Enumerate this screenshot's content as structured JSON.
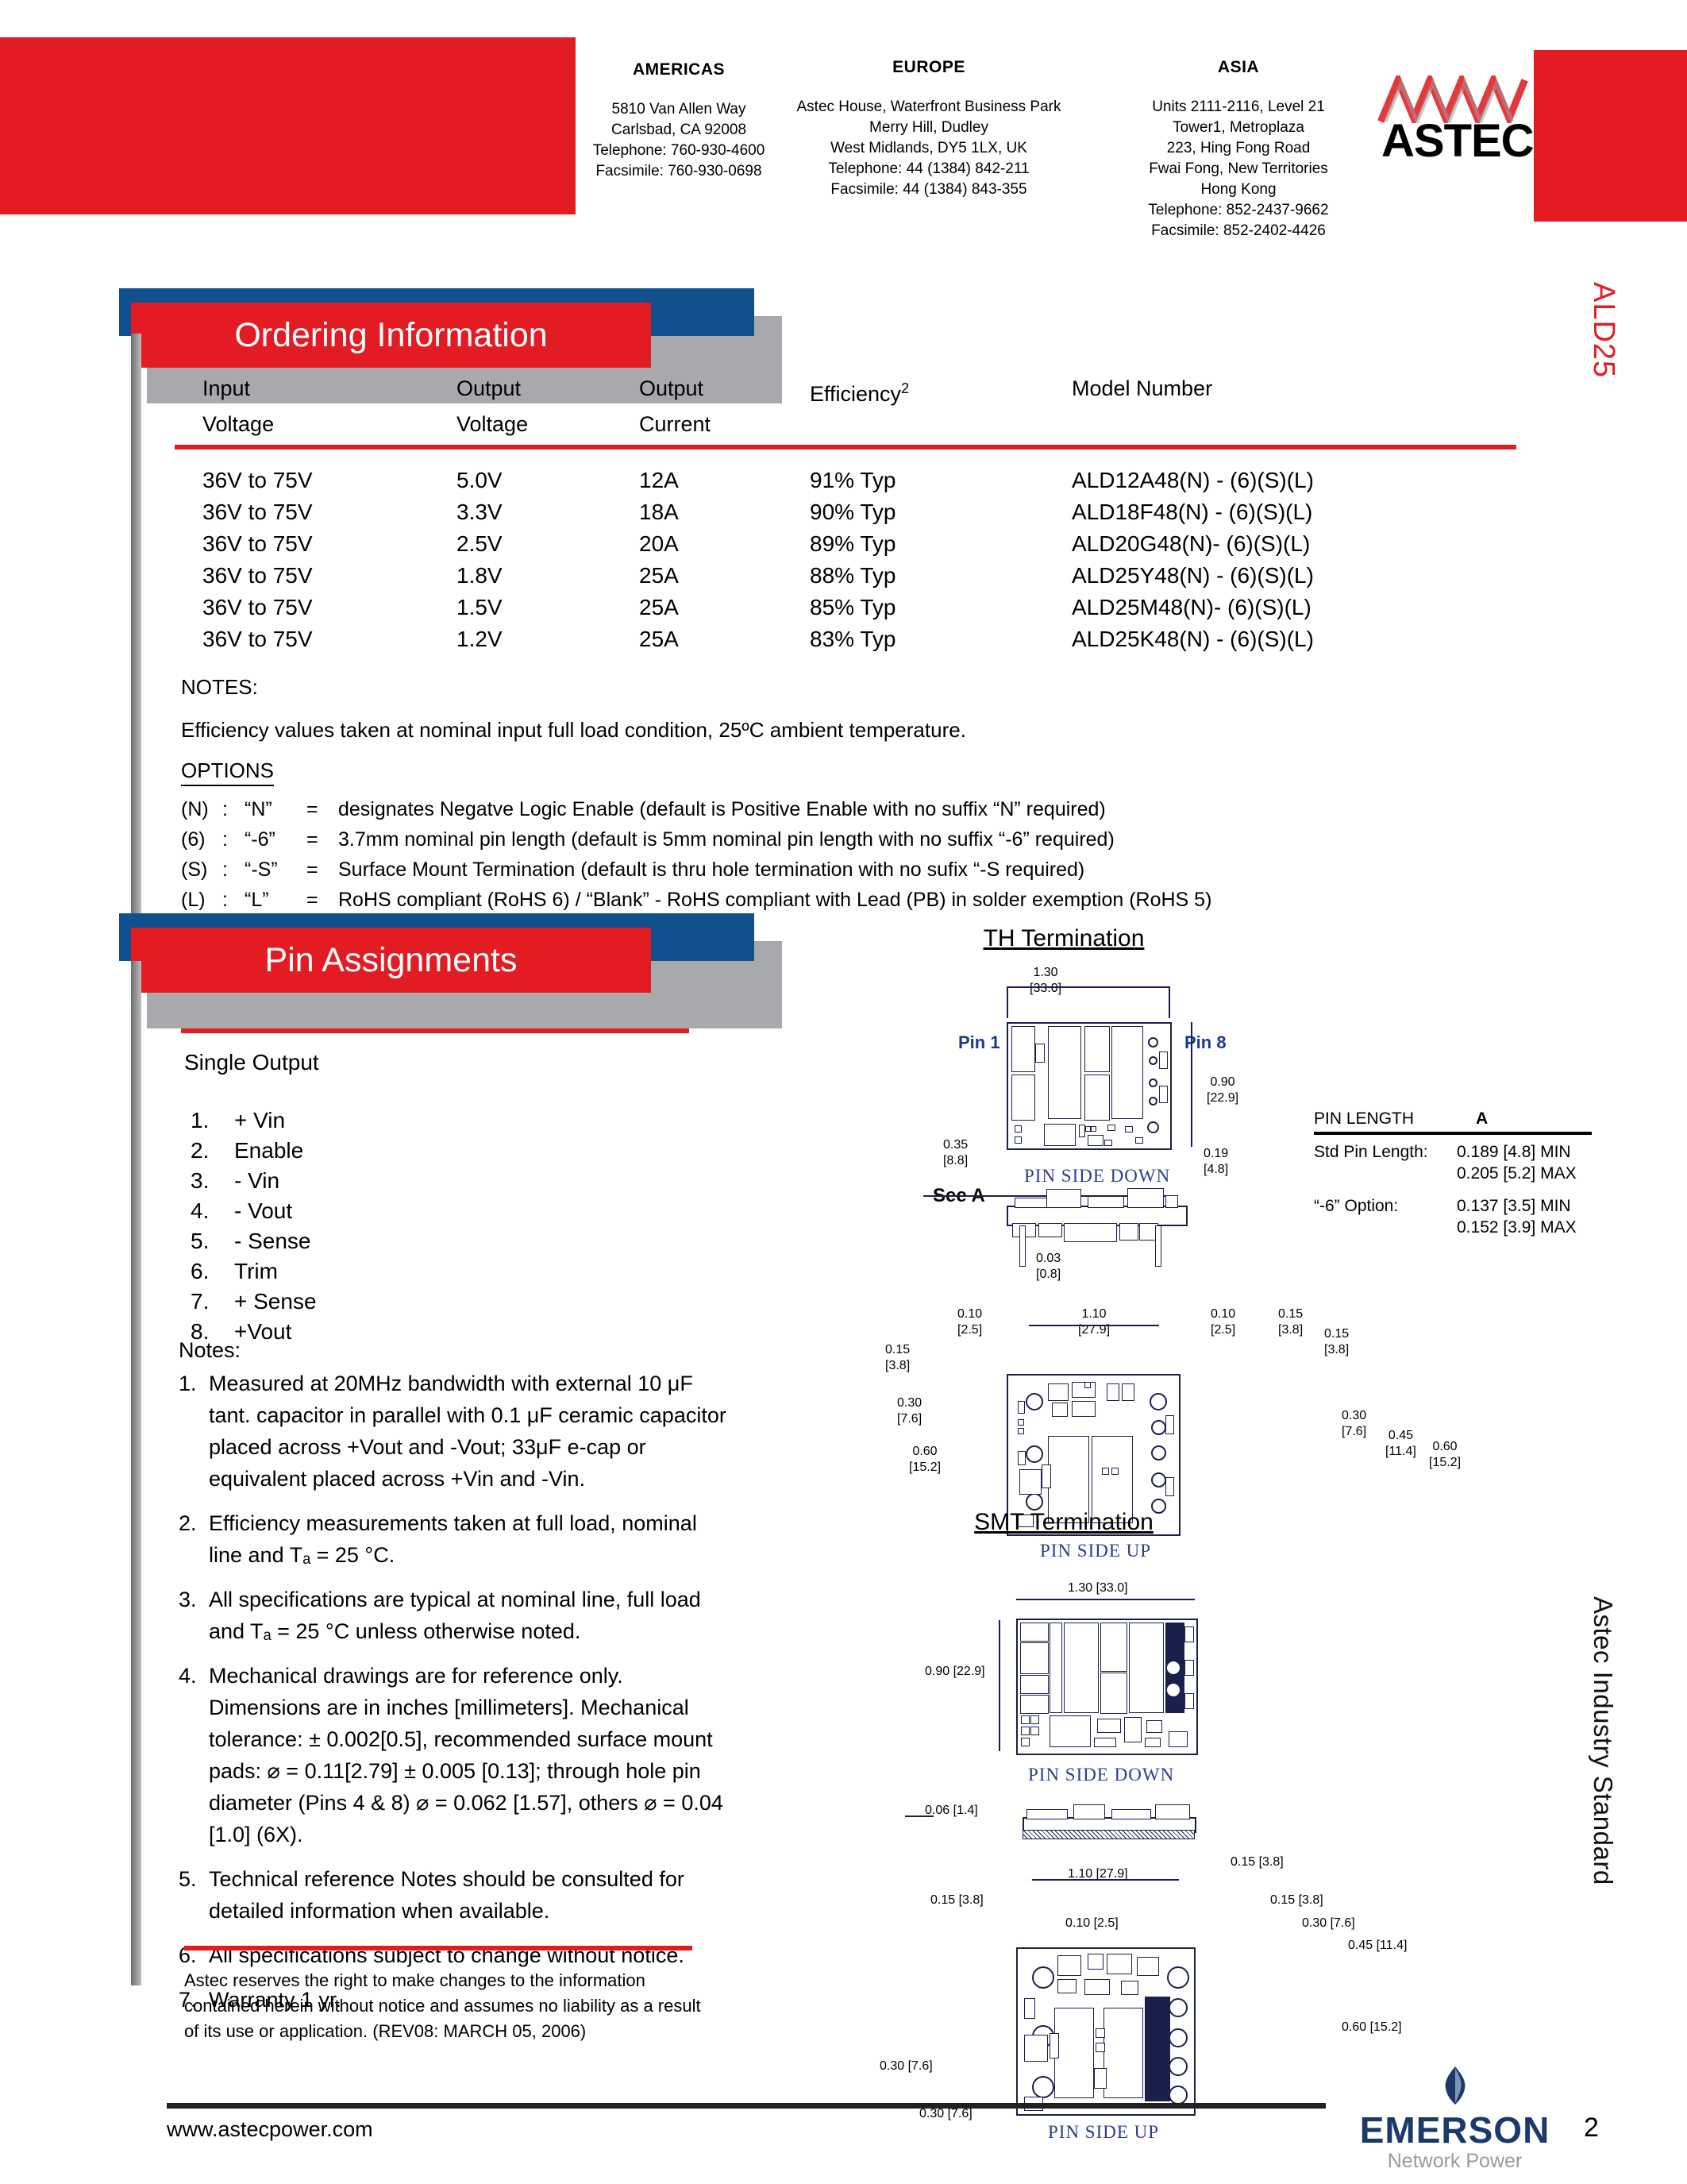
{
  "header": {
    "offices": [
      {
        "title": "AMERICAS",
        "lines": [
          "5810 Van Allen Way",
          "Carlsbad, CA 92008",
          "Telephone: 760-930-4600",
          "Facsimile: 760-930-0698"
        ]
      },
      {
        "title": "EUROPE",
        "lines": [
          "Astec House, Waterfront Business Park",
          "Merry Hill, Dudley",
          "West Midlands, DY5 1LX, UK",
          "Telephone: 44 (1384) 842-211",
          "Facsimile:  44 (1384) 843-355"
        ]
      },
      {
        "title": "ASIA",
        "lines": [
          "Units 2111-2116, Level 21",
          "Tower1, Metroplaza",
          "223, Hing Fong Road",
          "Fwai Fong, New Territories",
          "Hong Kong",
          "Telephone: 852-2437-9662",
          "Facsimile: 852-2402-4426"
        ]
      }
    ],
    "logo_text": "ASTEC"
  },
  "side_tabs": {
    "product": "ALD25",
    "family": "Astec Industry Standard"
  },
  "colors": {
    "red": "#e31c23",
    "blue": "#10508e",
    "gray": "#a7a9ac",
    "dark_gray": "#6d6e71",
    "drawing_blue": "#1b3a8f",
    "emerson_blue": "#1b3a6b"
  },
  "ordering": {
    "banner": "Ordering Information",
    "columns": [
      {
        "l1": "Input",
        "l2": "Voltage"
      },
      {
        "l1": "Output",
        "l2": "Voltage"
      },
      {
        "l1": "Output",
        "l2": "Current"
      },
      {
        "l1": "Efficiency",
        "sup": "2",
        "l2": ""
      },
      {
        "l1": "Model Number",
        "l2": ""
      }
    ],
    "rows": [
      {
        "vin": "36V to 75V",
        "vout": "5.0V",
        "iout": "12A",
        "eff": "91% Typ",
        "model": "ALD12A48(N) - (6)(S)(L)"
      },
      {
        "vin": "36V to 75V",
        "vout": "3.3V",
        "iout": "18A",
        "eff": "90% Typ",
        "model": "ALD18F48(N) - (6)(S)(L)"
      },
      {
        "vin": "36V to 75V",
        "vout": "2.5V",
        "iout": "20A",
        "eff": "89% Typ",
        "model": "ALD20G48(N)- (6)(S)(L)"
      },
      {
        "vin": "36V to 75V",
        "vout": "1.8V",
        "iout": "25A",
        "eff": "88% Typ",
        "model": "ALD25Y48(N) - (6)(S)(L)"
      },
      {
        "vin": "36V to 75V",
        "vout": "1.5V",
        "iout": "25A",
        "eff": "85% Typ",
        "model": "ALD25M48(N)- (6)(S)(L)"
      },
      {
        "vin": "36V to 75V",
        "vout": "1.2V",
        "iout": "25A",
        "eff": "83% Typ",
        "model": "ALD25K48(N) - (6)(S)(L)"
      }
    ],
    "notes_title": "NOTES:",
    "notes_text": "Efficiency values taken at nominal input full load condition, 25ºC ambient temperature.",
    "options_title": "OPTIONS",
    "options": [
      {
        "key": "(N)",
        "colon": ":",
        "code": "“N”",
        "eq": "=",
        "text": "designates Negatve Logic Enable (default is Positive Enable with no suffix “N” required)"
      },
      {
        "key": "(6)",
        "colon": ":",
        "code": "“-6”",
        "eq": "=",
        "text": "3.7mm nominal pin length (default is 5mm nominal pin length with no suffix “-6” required)"
      },
      {
        "key": "(S)",
        "colon": ":",
        "code": "“-S”",
        "eq": "=",
        "text": "Surface Mount Termination (default is thru hole termination with no sufix “-S required)"
      },
      {
        "key": "(L)",
        "colon": ":",
        "code": "“L”",
        "eq": "=",
        "text": "RoHS compliant (RoHS 6) / “Blank” - RoHS compliant with Lead (PB) in solder exemption (RoHS 5)"
      }
    ]
  },
  "pin_assignments": {
    "banner": "Pin Assignments",
    "subtitle": "Single Output",
    "pins": [
      {
        "n": "1.",
        "label": "+ Vin"
      },
      {
        "n": "2.",
        "label": "Enable"
      },
      {
        "n": "3.",
        "label": "- Vin"
      },
      {
        "n": "4.",
        "label": "- Vout"
      },
      {
        "n": "5.",
        "label": "- Sense"
      },
      {
        "n": "6.",
        "label": "Trim"
      },
      {
        "n": "7.",
        "label": "+ Sense"
      },
      {
        "n": "8.",
        "label": "+Vout"
      }
    ]
  },
  "left_notes": {
    "title": "Notes:",
    "items": [
      {
        "n": "1.",
        "text": "Measured at 20MHz bandwidth with external 10 μF tant. capacitor in parallel with 0.1 μF ceramic capacitor placed across +Vout and -Vout; 33μF e-cap or equivalent placed across +Vin and -Vin."
      },
      {
        "n": "2.",
        "text": "Efficiency measurements taken at full load, nominal line and Tₐ = 25 °C."
      },
      {
        "n": "3.",
        "text": "All specifications are typical at nominal line, full load and Tₐ = 25 °C unless otherwise noted."
      },
      {
        "n": "4.",
        "text": "Mechanical drawings are for reference only. Dimensions are in inches [millimeters]. Mechanical tolerance: ± 0.002[0.5], recommended surface mount pads: ⌀ = 0.11[2.79] ± 0.005 [0.13]; through hole pin diameter (Pins 4 & 8) ⌀ = 0.062 [1.57], others ⌀ = 0.04 [1.0] (6X)."
      },
      {
        "n": "5.",
        "text": "Technical reference Notes should be consulted for detailed information when available."
      },
      {
        "n": "6.",
        "text": "All specifications subject to change without notice."
      },
      {
        "n": "7.",
        "text": "Warranty 1 yr."
      }
    ]
  },
  "disclaimer": "Astec reserves the right to make changes to the information contained herein without notice and assumes no liability as a result of its use or application. (REV08: MARCH 05, 2006)",
  "mechanical": {
    "th": {
      "title": "TH Termination",
      "pin1": "Pin 1",
      "pin8": "Pin 8",
      "view_down": "PIN SIDE DOWN",
      "view_up": "PIN SIDE UP",
      "see_a": "See A",
      "dims": {
        "width_in": "1.30",
        "width_mm": "[33.0]",
        "height_in": "0.90",
        "height_mm": "[22.9]",
        "d035_in": "0.35",
        "d035_mm": "[8.8]",
        "d019_in": "0.19",
        "d019_mm": "[4.8]",
        "d003_in": "0.03",
        "d003_mm": "[0.8]",
        "d010_in": "0.10",
        "d010_mm": "[2.5]",
        "d110_in": "1.10",
        "d110_mm": "[27.9]",
        "d015_in": "0.15",
        "d015_mm": "[3.8]",
        "d030_in": "0.30",
        "d030_mm": "[7.6]",
        "d045_in": "0.45",
        "d045_mm": "[11.4]",
        "d060_in": "0.60",
        "d060_mm": "[15.2]"
      }
    },
    "pin_length_table": {
      "h1": "PIN LENGTH",
      "h2": "A",
      "rows": [
        {
          "k": "Std Pin Length:",
          "v1": "0.189 [4.8] MIN",
          "v2": "0.205 [5.2] MAX"
        },
        {
          "k": "“-6” Option:",
          "v1": "0.137 [3.5] MIN",
          "v2": "0.152 [3.9] MAX"
        }
      ]
    },
    "smt": {
      "title": "SMT Termination",
      "view_down": "PIN SIDE DOWN",
      "view_up": "PIN SIDE UP",
      "dims": {
        "width": "1.30 [33.0]",
        "height": "0.90 [22.9]",
        "d006": "0.06 [1.4]",
        "d015": "0.15 [3.8]",
        "d110": "1.10 [27.9]",
        "d010": "0.10 [2.5]",
        "d030": "0.30 [7.6]",
        "d045": "0.45 [11.4]",
        "d060": "0.60 [15.2]"
      }
    }
  },
  "footer": {
    "url": "www.astecpower.com",
    "page": "2",
    "emerson_word": "EMERSON",
    "emerson_sub": "Network Power"
  }
}
